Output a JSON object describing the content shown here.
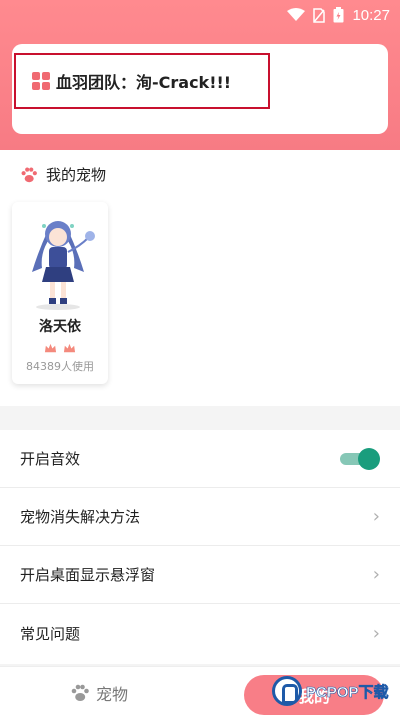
{
  "status_bar": {
    "time": "10:27"
  },
  "header": {
    "team_text": "血羽团队：洵-Crack!!!"
  },
  "pets": {
    "title": "我的宠物",
    "items": [
      {
        "name": "洛天依",
        "usage": "84389人使用",
        "stars": 2
      }
    ]
  },
  "settings": {
    "items": [
      {
        "label": "开启音效",
        "type": "toggle",
        "on": true
      },
      {
        "label": "宠物消失解决方法",
        "type": "link"
      },
      {
        "label": "开启桌面显示悬浮窗",
        "type": "link"
      },
      {
        "label": "常见问题",
        "type": "link"
      }
    ],
    "chevron": "›"
  },
  "bottom_nav": {
    "pet_label": "宠物",
    "mine_label": "我的",
    "watermark": "PCPOP下载"
  },
  "colors": {
    "header_pink": "#f77b84",
    "toggle_on": "#1a9d7d",
    "highlight_box": "#c8102e"
  }
}
